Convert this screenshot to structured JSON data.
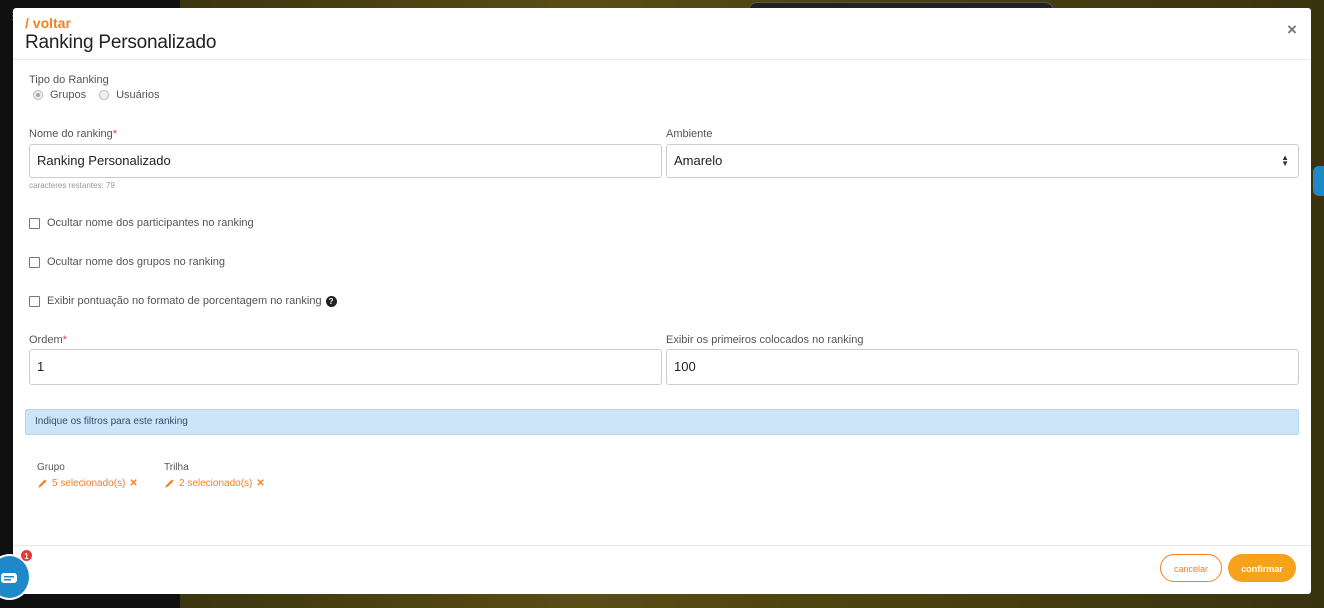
{
  "header": {
    "back_label": "/ voltar",
    "title": "Ranking Personalizado",
    "close_label": "×"
  },
  "ranking_type": {
    "label": "Tipo do Ranking",
    "options": [
      "Grupos",
      "Usuários"
    ],
    "selected": "Grupos"
  },
  "form": {
    "name_label": "Nome do ranking",
    "name_value": "Ranking Personalizado",
    "chars_remaining": "caracteres restantes: 79",
    "environment_label": "Ambiente",
    "environment_value": "Amarelo",
    "checkboxes": [
      {
        "label": "Ocultar nome dos participantes no ranking",
        "checked": false
      },
      {
        "label": "Ocultar nome dos grupos no ranking",
        "checked": false
      },
      {
        "label": "Exibir pontuação no formato de porcentagem no ranking",
        "checked": false
      }
    ],
    "order_label": "Ordem",
    "order_value": "1",
    "top_label": "Exibir os primeiros colocados no ranking",
    "top_value": "100",
    "required_mark": "*"
  },
  "filters": {
    "info_text": "Indique os filtros para este ranking",
    "items": [
      {
        "label": "Grupo",
        "value": "5 selecionado(s)"
      },
      {
        "label": "Trilha",
        "value": "2 selecionado(s)"
      }
    ]
  },
  "footer": {
    "cancel_label": "cancelar",
    "confirm_label": "confirmar"
  },
  "chat": {
    "badge_count": "1"
  },
  "colors": {
    "accent": "#f58220",
    "confirm": "#f7a21b",
    "info_bg": "#cde5f9",
    "chat": "#1e88c8",
    "badge": "#e53935"
  }
}
